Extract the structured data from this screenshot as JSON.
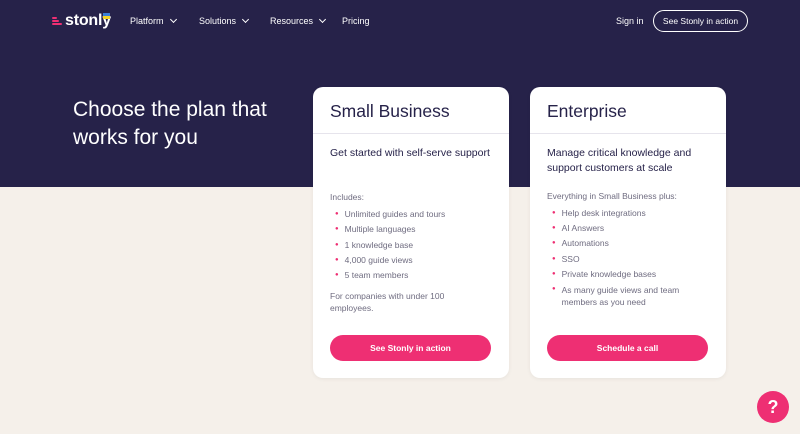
{
  "brand": {
    "name": "stonly",
    "accent": "#ee2f73",
    "navy": "#262249",
    "flag_top": "#3b7fd9",
    "flag_bottom": "#f5d327"
  },
  "nav": {
    "items": [
      {
        "label": "Platform",
        "has_dropdown": true
      },
      {
        "label": "Solutions",
        "has_dropdown": true
      },
      {
        "label": "Resources",
        "has_dropdown": true
      },
      {
        "label": "Pricing",
        "has_dropdown": false
      }
    ],
    "signin": "Sign in",
    "cta": "See Stonly in action"
  },
  "hero": {
    "title": "Choose the plan that works for you"
  },
  "plans": [
    {
      "name": "Small Business",
      "subtitle": "Get started with self-serve support",
      "includes_label": "Includes:",
      "features": [
        "Unlimited guides and tours",
        "Multiple languages",
        "1 knowledge base",
        "4,000 guide views",
        "5 team members"
      ],
      "note": "For companies with under 100 employees.",
      "button": "See Stonly in action"
    },
    {
      "name": "Enterprise",
      "subtitle": "Manage critical knowledge and support customers at scale",
      "includes_label": "Everything in Small Business plus:",
      "features": [
        "Help desk integrations",
        "AI Answers",
        "Automations",
        "SSO",
        "Private knowledge bases",
        "As many guide views and team members as you need"
      ],
      "button": "Schedule a call"
    }
  ],
  "help": {
    "icon": "question-icon",
    "glyph": "?"
  }
}
